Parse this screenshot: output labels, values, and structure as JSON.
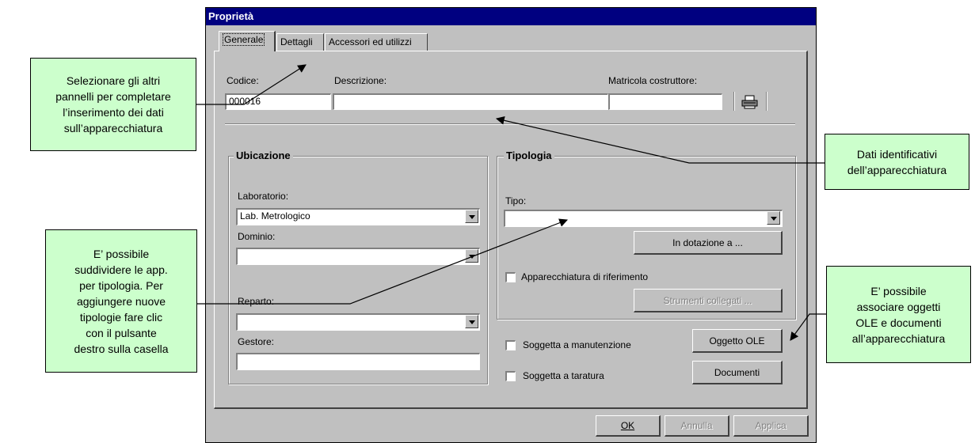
{
  "dialog": {
    "title": "Proprietà",
    "tabs": [
      "Generale",
      "Dettagli",
      "Accessori ed utilizzi"
    ],
    "codice_label": "Codice:",
    "codice_value": "000016",
    "descrizione_label": "Descrizione:",
    "descrizione_value": "",
    "matricola_label": "Matricola costruttore:",
    "matricola_value": "",
    "ubicazione": {
      "legend": "Ubicazione",
      "laboratorio_label": "Laboratorio:",
      "laboratorio_value": "Lab. Metrologico",
      "dominio_label": "Dominio:",
      "dominio_value": "",
      "reparto_label": "Reparto:",
      "reparto_value": "",
      "gestore_label": "Gestore:",
      "gestore_value": ""
    },
    "tipologia": {
      "legend": "Tipologia",
      "tipo_label": "Tipo:",
      "tipo_value": "",
      "in_dotazione_button": "In dotazione a ...",
      "riferimento_checkbox": "Apparecchiatura di riferimento",
      "strumenti_button": "Strumenti collegati ..."
    },
    "manutenzione_checkbox": "Soggetta a manutenzione",
    "taratura_checkbox": "Soggetta a taratura",
    "oggetto_ole_button": "Oggetto OLE",
    "documenti_button": "Documenti",
    "ok_button": "OK",
    "annulla_button": "Annulla",
    "applica_button": "Applica"
  },
  "callouts": {
    "left_top": [
      "Selezionare gli altri",
      "pannelli per completare",
      "l’inserimento dei dati",
      "sull’apparecchiatura"
    ],
    "left_bottom": [
      "E’ possibile",
      "suddividere le app.",
      "per tipologia. Per",
      "aggiungere nuove",
      "tipologie fare clic",
      "con il pulsante",
      "destro sulla casella"
    ],
    "right_top": [
      "Dati identificativi",
      "dell’apparecchiatura"
    ],
    "right_bottom": [
      "E’ possibile",
      "associare oggetti",
      "OLE e documenti",
      "all’apparecchiatura"
    ]
  },
  "colors": {
    "titlebar": "#000080",
    "dialog_bg": "#c0c0c0",
    "callout_bg": "#ccffcc"
  },
  "icons": [
    "printer-icon",
    "dropdown-arrow-icon",
    "checkbox-icon"
  ]
}
